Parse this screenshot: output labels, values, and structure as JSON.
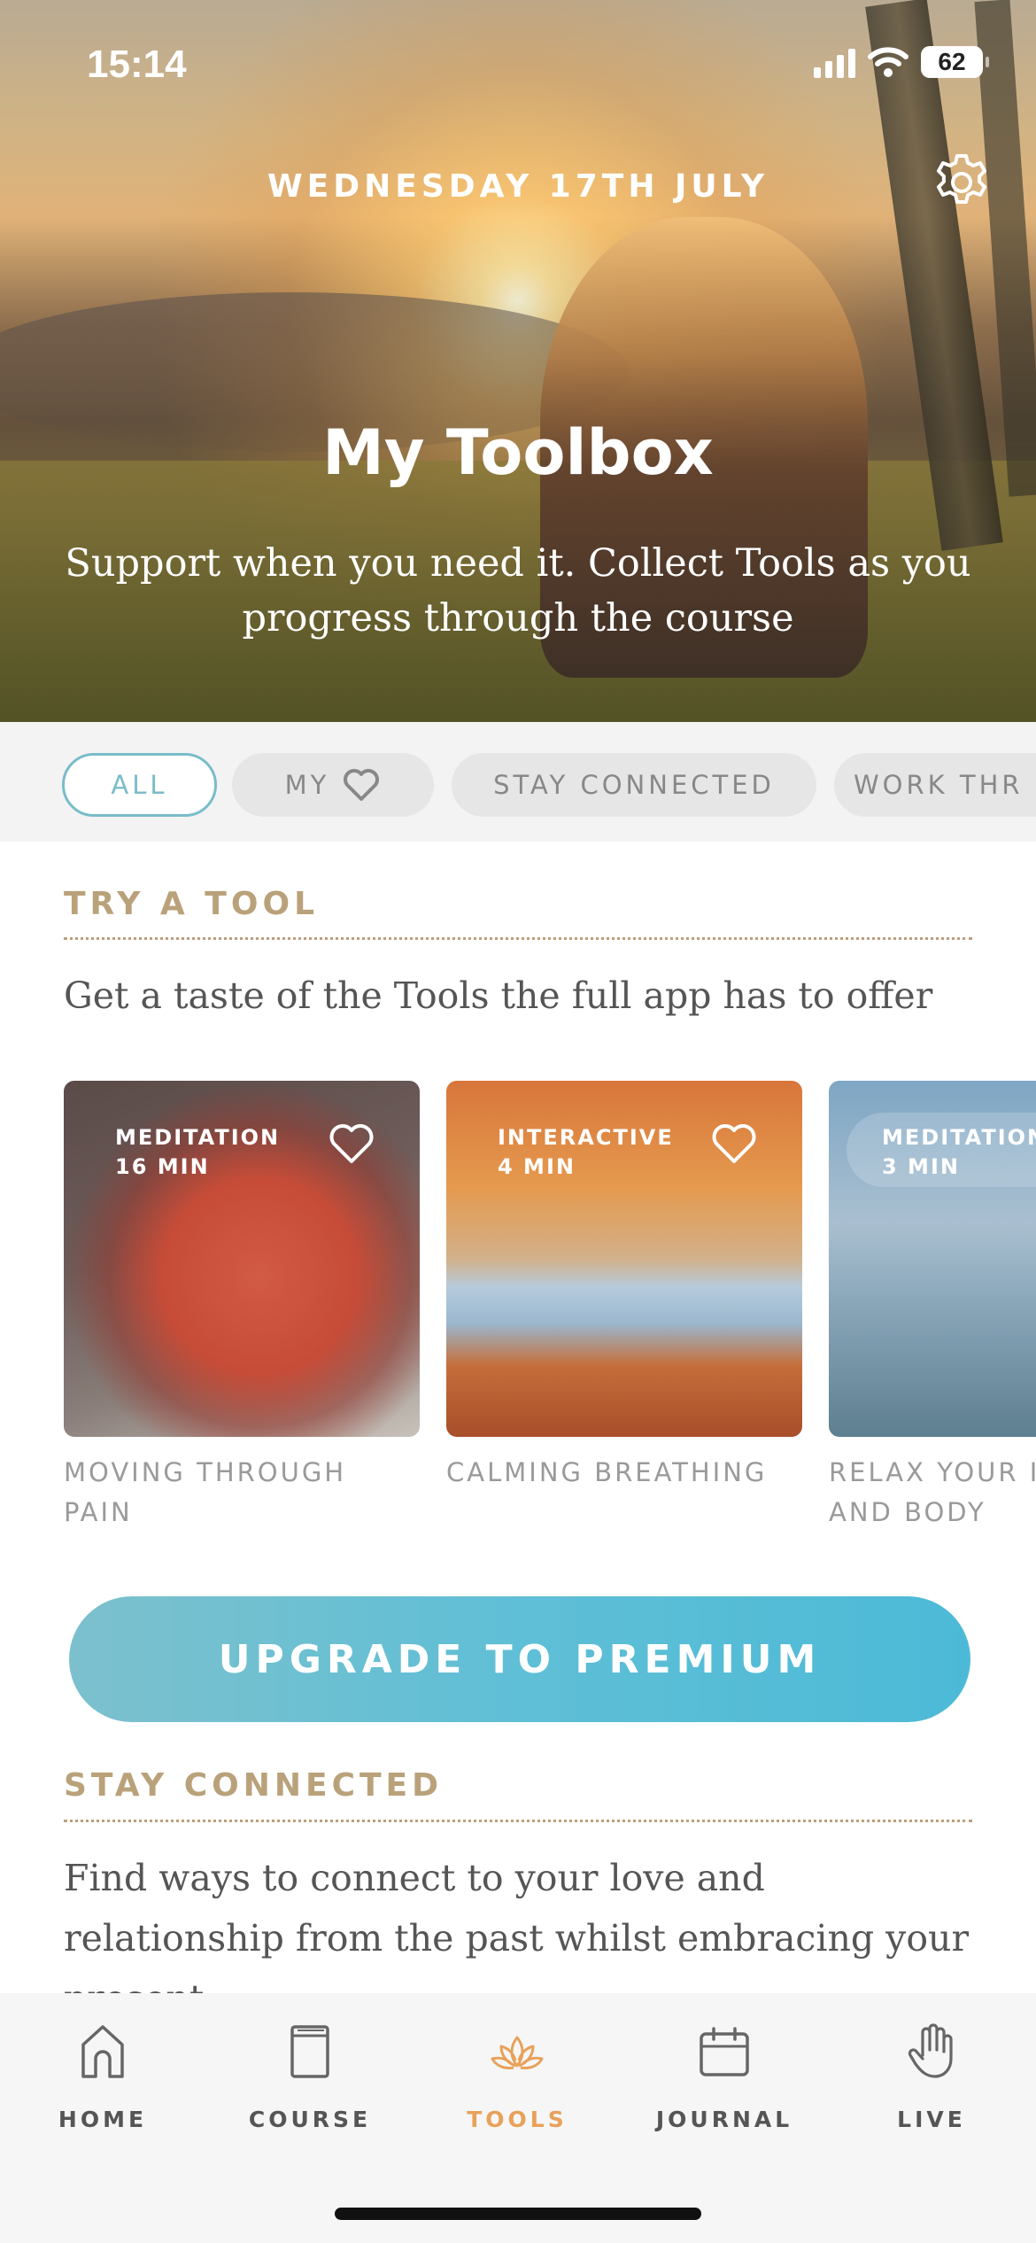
{
  "status_bar": {
    "time": "15:14",
    "battery": "62"
  },
  "header": {
    "date": "WEDNESDAY 17TH JULY",
    "title": "My Toolbox",
    "subtitle": "Support when you need it. Collect Tools as you progress through the course"
  },
  "filters": [
    {
      "label": "ALL",
      "active": true
    },
    {
      "label": "MY",
      "icon": "heart-icon"
    },
    {
      "label": "STAY CONNECTED"
    },
    {
      "label": "WORK THR"
    }
  ],
  "try_a_tool": {
    "title": "TRY A TOOL",
    "description": "Get a taste of the Tools the full app has to offer",
    "cards": [
      {
        "type": "MEDITATION",
        "duration": "16 MIN",
        "title_line1": "MOVING THROUGH",
        "title_line2": "PAIN"
      },
      {
        "type": "INTERACTIVE",
        "duration": "4 MIN",
        "title_line1": "CALMING BREATHING",
        "title_line2": ""
      },
      {
        "type": "MEDITATION",
        "duration": "3 MIN",
        "title_line1": "RELAX YOUR I",
        "title_line2": "AND BODY"
      }
    ]
  },
  "upgrade_button": "UPGRADE TO PREMIUM",
  "stay_connected": {
    "title": "STAY CONNECTED",
    "description": "Find ways to connect to your love and relationship from the past whilst embracing your present"
  },
  "tabs": [
    {
      "label": "HOME",
      "icon": "home-icon"
    },
    {
      "label": "COURSE",
      "icon": "book-icon"
    },
    {
      "label": "TOOLS",
      "icon": "lotus-icon",
      "active": true
    },
    {
      "label": "JOURNAL",
      "icon": "calendar-icon"
    },
    {
      "label": "LIVE",
      "icon": "hand-icon"
    }
  ],
  "colors": {
    "accent_teal": "#79bcc9",
    "section_gold": "#b9a17a",
    "active_tab": "#e8a15a"
  }
}
